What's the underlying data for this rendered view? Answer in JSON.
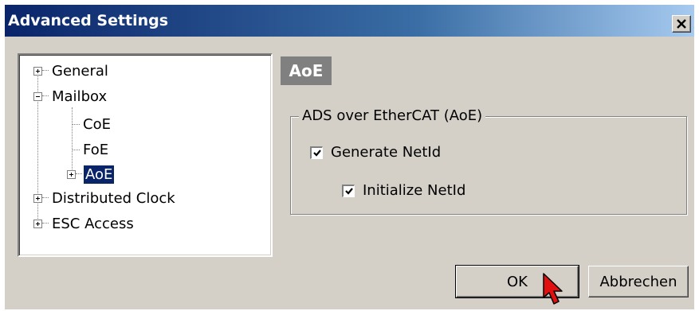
{
  "window": {
    "title": "Advanced Settings",
    "close_glyph": "×",
    "close_icon": "close-icon"
  },
  "tree": {
    "items": [
      {
        "label": "General",
        "expander": "plus",
        "level": 0
      },
      {
        "label": "Mailbox",
        "expander": "minus",
        "level": 0
      },
      {
        "label": "CoE",
        "expander": "none",
        "level": 1
      },
      {
        "label": "FoE",
        "expander": "none",
        "level": 1
      },
      {
        "label": "AoE",
        "expander": "plus",
        "level": 1,
        "selected": true
      },
      {
        "label": "Distributed Clock",
        "expander": "plus",
        "level": 0
      },
      {
        "label": "ESC Access",
        "expander": "plus",
        "level": 0
      }
    ]
  },
  "panel": {
    "heading": "AoE",
    "group_title": "ADS over EtherCAT (AoE)",
    "generate_netid": {
      "label": "Generate NetId",
      "checked": true
    },
    "initialize_netid": {
      "label": "Initialize NetId",
      "checked": true
    }
  },
  "buttons": {
    "ok": "OK",
    "cancel": "Abbrechen"
  },
  "colors": {
    "title_start": "#0a246a",
    "title_end": "#a6caf0",
    "selection": "#0a246a",
    "dialog_bg": "#d4d0c8"
  }
}
